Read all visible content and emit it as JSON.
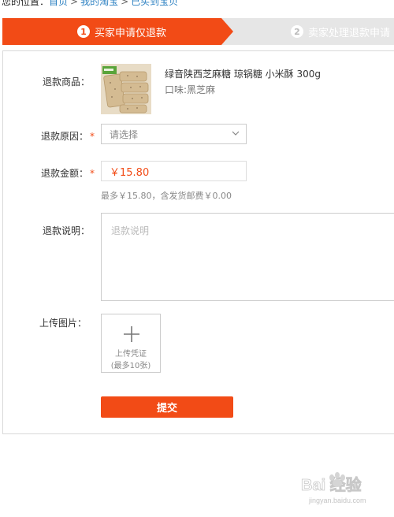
{
  "breadcrumb": {
    "prefix": "您的位置：",
    "home": "首页",
    "sep": ">",
    "mytaobao": "我的淘宝",
    "current": "已买到宝贝"
  },
  "steps": [
    {
      "num": "1",
      "label": "买家申请仅退款"
    },
    {
      "num": "2",
      "label": "卖家处理退款申请"
    }
  ],
  "form": {
    "product_label": "退款商品：",
    "product_title": "绿音陕西芝麻糖 琼锅糖 小米酥 300g",
    "product_flavor": "口味:黑芝麻",
    "reason_label": "退款原因：",
    "reason_placeholder": "请选择",
    "amount_label": "退款金额：",
    "amount_value": "￥15.80",
    "amount_hint": "最多￥15.80，含发货邮费￥0.00",
    "desc_label": "退款说明：",
    "desc_placeholder": "退款说明",
    "upload_label": "上传图片：",
    "upload_text": "上传凭证",
    "upload_sub": "(最多10张)",
    "required_mark": "*",
    "submit_label": "提交"
  },
  "watermark": {
    "text": "Bai 经验",
    "sub": "jingyan.baidu.com"
  },
  "colors": {
    "accent": "#f24b16",
    "step_inactive": "#e6e6e6",
    "link": "#2a7fc1"
  }
}
